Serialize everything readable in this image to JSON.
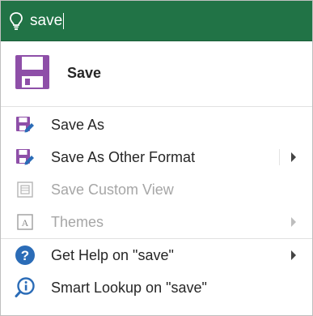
{
  "search": {
    "icon": "lightbulb-icon",
    "query": "save"
  },
  "top_result": {
    "icon": "floppy-disk-icon",
    "label": "Save"
  },
  "items": [
    {
      "label": "Save As",
      "icon": "save-as-icon",
      "enabled": true,
      "submenu": false
    },
    {
      "label": "Save As Other Format",
      "icon": "save-as-other-format-icon",
      "enabled": true,
      "submenu": true
    },
    {
      "label": "Save Custom View",
      "icon": "custom-view-icon",
      "enabled": false,
      "submenu": false
    },
    {
      "label": "Themes",
      "icon": "themes-icon",
      "enabled": false,
      "submenu": true
    },
    {
      "label": "Get Help on \"save\"",
      "icon": "help-icon",
      "enabled": true,
      "submenu": true
    },
    {
      "label": "Smart Lookup on \"save\"",
      "icon": "smart-lookup-icon",
      "enabled": true,
      "submenu": false
    }
  ],
  "colors": {
    "accent": "#217346",
    "save_purple": "#8e4fa8",
    "help_blue": "#2b6cb7",
    "disabled": "#a6a6a6"
  }
}
